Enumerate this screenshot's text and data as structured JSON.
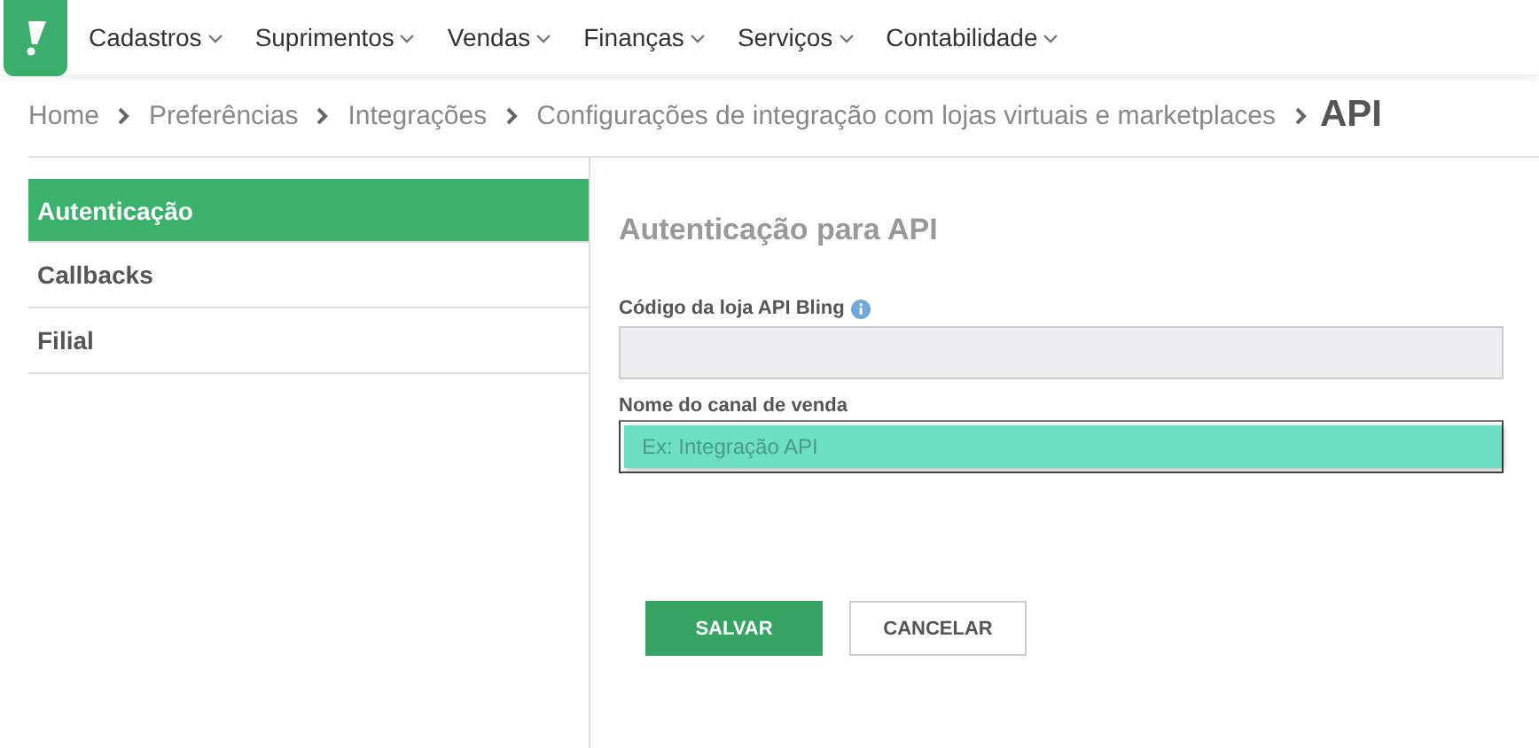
{
  "menu": [
    {
      "label": "Cadastros"
    },
    {
      "label": "Suprimentos"
    },
    {
      "label": "Vendas"
    },
    {
      "label": "Finanças"
    },
    {
      "label": "Serviços"
    },
    {
      "label": "Contabilidade"
    }
  ],
  "breadcrumb": [
    "Home",
    "Preferências",
    "Integrações",
    "Configurações de integração com lojas virtuais e marketplaces"
  ],
  "page_title": "API",
  "sidebar": {
    "items": [
      {
        "label": "Autenticação",
        "selected": true
      },
      {
        "label": "Callbacks",
        "selected": false
      },
      {
        "label": "Filial",
        "selected": false
      }
    ]
  },
  "form": {
    "title": "Autenticação para API",
    "fields": [
      {
        "label": "Código da loja API Bling",
        "info": true,
        "disabled": true,
        "highlighted": false
      },
      {
        "label": "Nome do canal de venda",
        "info": false,
        "disabled": false,
        "highlighted": true,
        "placeholder": "Ex: Integração API"
      }
    ],
    "buttons": [
      {
        "label": "SALVAR",
        "kind": "primary"
      },
      {
        "label": "CANCELAR",
        "kind": "secondary"
      }
    ]
  }
}
